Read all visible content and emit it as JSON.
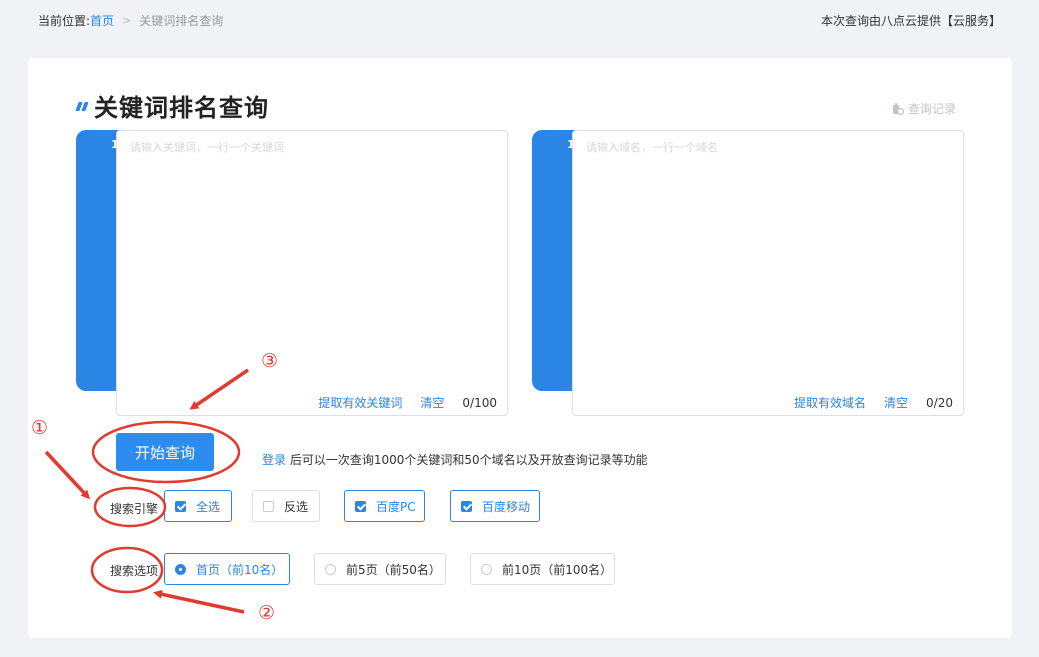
{
  "breadcrumb": {
    "prefix": "当前位置:",
    "home": "首页",
    "current": "关键词排名查询"
  },
  "provider": "本次查询由八点云提供【云服务】",
  "page": {
    "title": "关键词排名查询",
    "history_label": "查询记录"
  },
  "keyword_editor": {
    "line_number": "1",
    "placeholder": "请输入关键词，一行一个关键词",
    "extract_label": "提取有效关键词",
    "clear_label": "清空",
    "count": "0/100"
  },
  "domain_editor": {
    "line_number": "1",
    "placeholder": "请输入域名，一行一个域名",
    "extract_label": "提取有效域名",
    "clear_label": "清空",
    "count": "0/20"
  },
  "start_button": "开始查询",
  "login_tip": {
    "link": "登录",
    "text": " 后可以一次查询1000个关键词和50个域名以及开放查询记录等功能"
  },
  "engines": {
    "label": "搜索引擎",
    "options": [
      {
        "label": "全选",
        "checked": true
      },
      {
        "label": "反选",
        "checked": false
      },
      {
        "label": "百度PC",
        "checked": true
      },
      {
        "label": "百度移动",
        "checked": true
      }
    ]
  },
  "search_options": {
    "label": "搜索选项",
    "options": [
      {
        "label": "首页（前10名）",
        "selected": true
      },
      {
        "label": "前5页（前50名）",
        "selected": false
      },
      {
        "label": "前10页（前100名）",
        "selected": false
      }
    ]
  },
  "annotations": {
    "one": "①",
    "two": "②",
    "three": "③"
  },
  "colors": {
    "accent": "#2b85e4",
    "annotation": "#e23a2e"
  }
}
